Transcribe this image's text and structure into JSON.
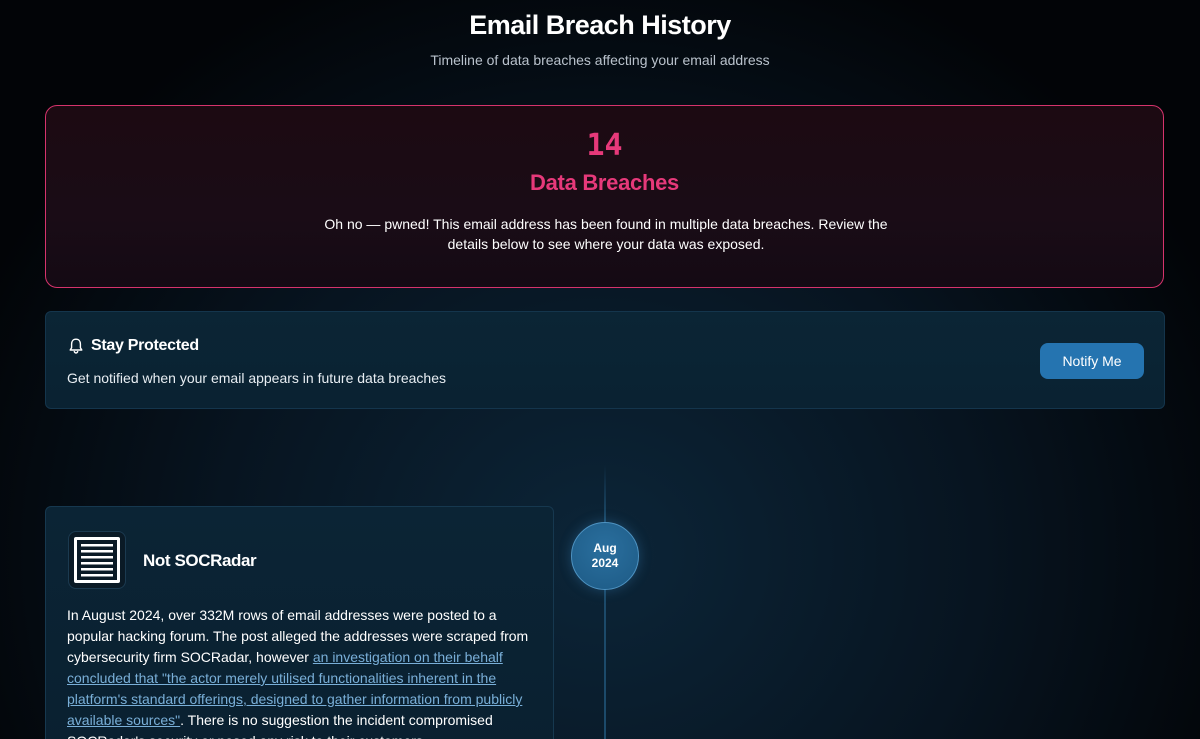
{
  "header": {
    "title": "Email Breach History",
    "subtitle": "Timeline of data breaches affecting your email address"
  },
  "summary": {
    "count": "14",
    "label": "Data Breaches",
    "message": "Oh no — pwned! This email address has been found in multiple data breaches. Review the details below to see where your data was exposed."
  },
  "protect": {
    "icon": "bell-icon",
    "title": "Stay Protected",
    "description": "Get notified when your email appears in future data breaches",
    "button_label": "Notify Me"
  },
  "timeline": {
    "items": [
      {
        "month": "Aug",
        "year": "2024",
        "icon": "document-icon",
        "name": "Not SOCRadar",
        "description_before": "In August 2024, over 332M rows of email addresses were posted to a popular hacking forum. The post alleged the addresses were scraped from cybersecurity firm SOCRadar, however ",
        "description_link": "an investigation on their behalf concluded that \"the actor merely utilised functionalities inherent in the platform's standard offerings, designed to gather information from publicly available sources\"",
        "description_after": ". There is no suggestion the incident compromised SOCRadar's security or posed any risk to their customers."
      }
    ]
  },
  "colors": {
    "accent_pink": "#e6397a",
    "button_blue": "#2574b0",
    "link_blue": "#79afd8"
  }
}
